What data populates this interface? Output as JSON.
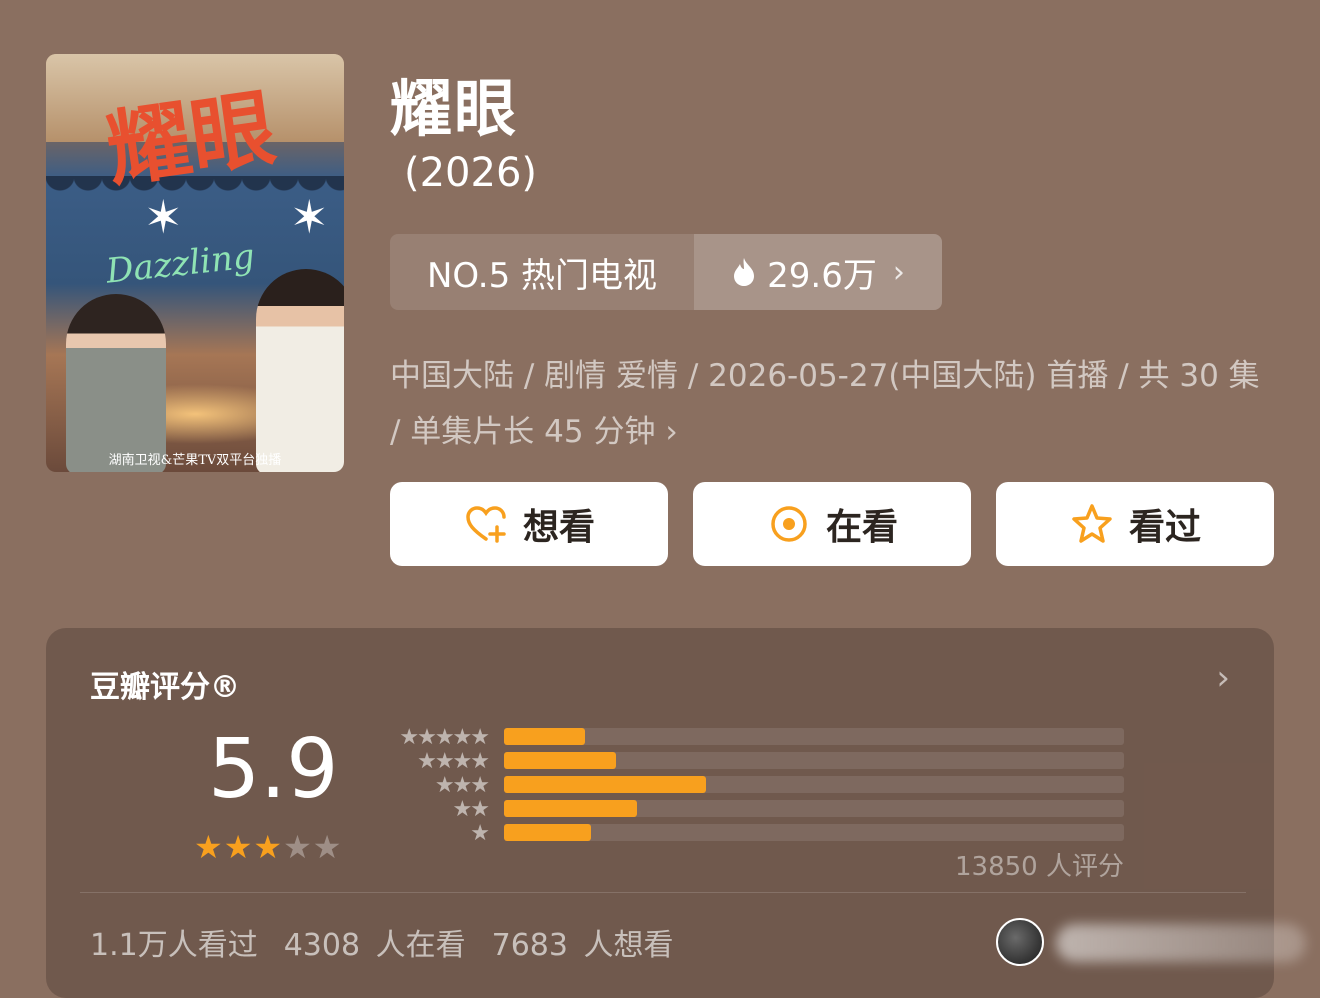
{
  "poster": {
    "title_art": "耀眼",
    "subtitle_art": "Dazzling",
    "caption": "湖南卫视&芒果TV双平台独播"
  },
  "header": {
    "title": "耀眼",
    "year": "(2026)"
  },
  "rank": {
    "label": "NO.5 热门电视",
    "heat": "29.6万"
  },
  "meta": {
    "text": "中国大陆 / 剧情 爱情 / 2026-05-27(中国大陆) 首播 / 共 30 集 / 单集片长 45 分钟"
  },
  "actions": {
    "want": "想看",
    "watching": "在看",
    "watched": "看过"
  },
  "rating": {
    "label": "豆瓣评分®",
    "score": "5.9",
    "stars": 3,
    "max_stars": 5,
    "distribution_fraction": [
      0.13,
      0.18,
      0.325,
      0.215,
      0.14
    ],
    "count_text": "13850 人评分",
    "watched_text": "1.1万人看过",
    "watching_text": "4308 人在看",
    "want_text": "7683 人想看"
  },
  "colors": {
    "background": "#8a6f60",
    "accent": "#f8a01e",
    "button_bg": "#ffffff"
  }
}
